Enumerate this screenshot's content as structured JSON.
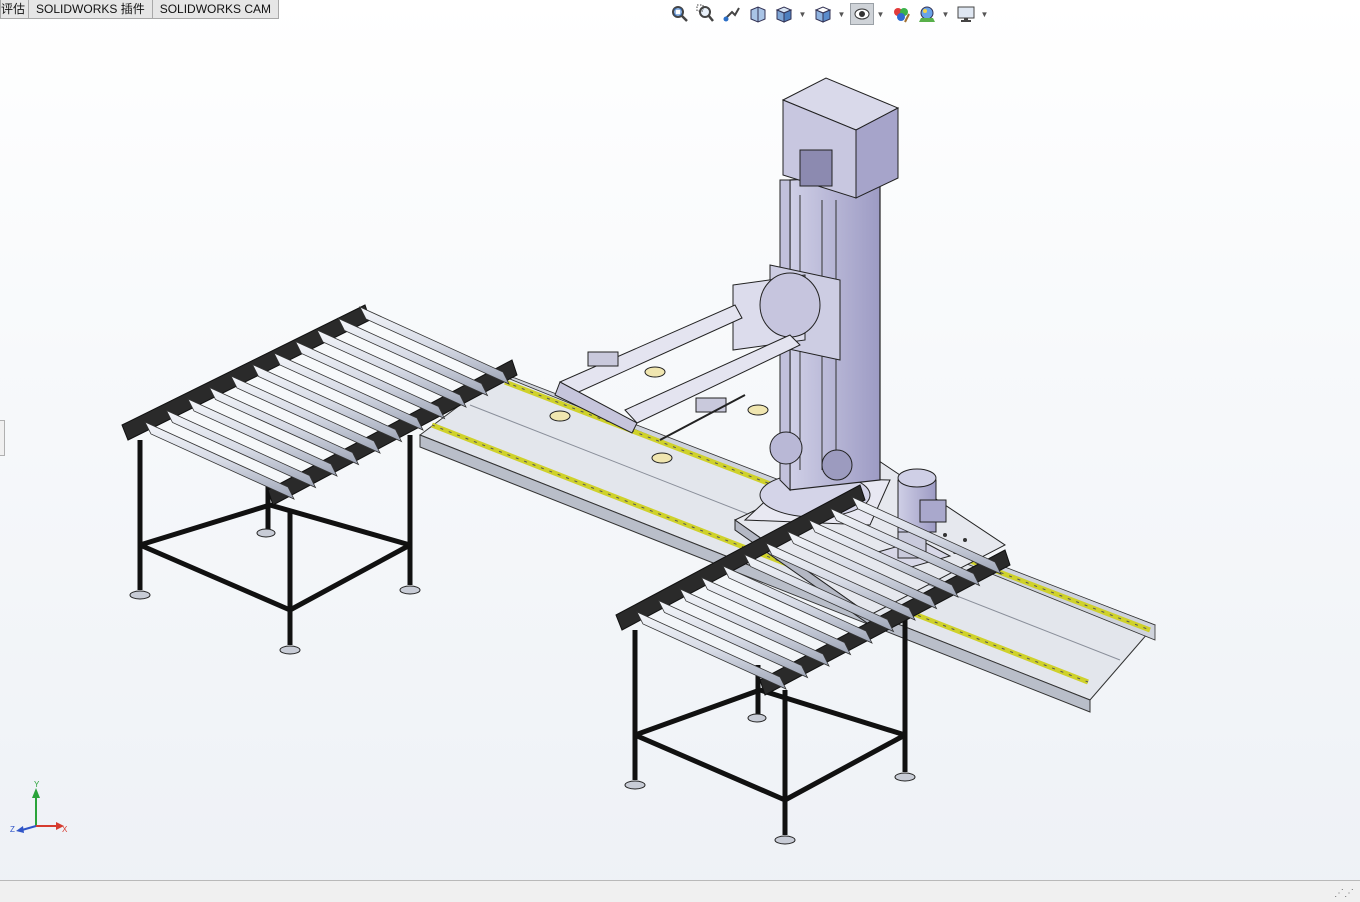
{
  "tabs": [
    {
      "label": "评估"
    },
    {
      "label": "SOLIDWORKS 插件"
    },
    {
      "label": "SOLIDWORKS CAM"
    }
  ],
  "toolbar": {
    "icons": [
      "zoom-to-fit-icon",
      "zoom-to-area-icon",
      "previous-view-icon",
      "section-view-icon",
      "view-orientation-icon",
      "display-style-icon",
      "hide-show-items-icon",
      "edit-appearance-icon",
      "apply-scene-icon",
      "view-settings-icon"
    ]
  },
  "triad": {
    "x": "X",
    "y": "Y",
    "z": "Z"
  },
  "colors": {
    "steel": "#1a1a1a",
    "roller": "#d8dce6",
    "machine": "#b7b6d6",
    "rail": "#e1e4ea",
    "guide": "#cfd12a"
  }
}
